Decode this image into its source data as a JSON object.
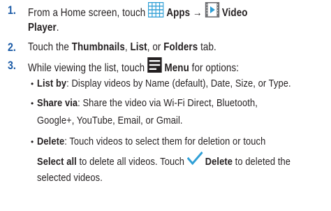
{
  "steps": [
    {
      "number": "1.",
      "line1": {
        "text_a": "From a Home screen, touch",
        "apps_label": "Apps",
        "arrow": "→",
        "video_player_label_1": "Video"
      },
      "line2": {
        "video_player_label_2": "Player",
        "period": "."
      }
    },
    {
      "number": "2.",
      "text_a": "Touch the",
      "tab_thumbnails": "Thumbnails",
      "comma1": ",",
      "tab_list": "List",
      "comma_or": ", or",
      "tab_folders": "Folders",
      "text_b": "tab."
    },
    {
      "number": "3.",
      "text_a": "While viewing the list, touch",
      "menu_label": "Menu",
      "text_b": "for options:"
    }
  ],
  "options": {
    "list_by": {
      "label": "List by",
      "text": ": Display videos by Name (default), Date, Size, or Type."
    },
    "share_via": {
      "label": "Share via",
      "text_line1": ": Share the video via Wi-Fi Direct, Bluetooth,",
      "text_line2": "Google+, YouTube, Email, or Gmail."
    },
    "delete": {
      "label": "Delete",
      "text_line1": ": Touch videos to select them for deletion or touch",
      "select_all_label": "Select all",
      "text_a": "to delete all videos. Touch",
      "delete_button_label": "Delete",
      "text_b": "to deleted the",
      "text_line3": "selected videos."
    }
  },
  "bullet_char": "•",
  "icons": {
    "apps": "apps-grid-icon",
    "video_player": "video-player-icon",
    "menu": "menu-icon",
    "checkmark": "checkmark-icon"
  },
  "colors": {
    "number": "#1a5aa6",
    "text": "#231f20",
    "apps_icon": "#2f9fd6",
    "video_icon_border": "#6d6e71",
    "video_icon_play": "#2f9fd6",
    "menu_icon_bg": "#231f20",
    "check": "#2f9fd6"
  }
}
